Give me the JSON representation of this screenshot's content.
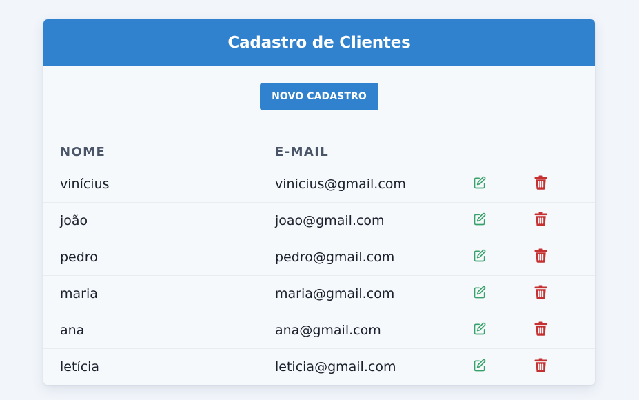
{
  "header": {
    "title": "Cadastro de Clientes"
  },
  "actions": {
    "new_label": "NOVO CADASTRO"
  },
  "table": {
    "columns": [
      "NOME",
      "E-MAIL"
    ],
    "rows": [
      {
        "name": "vinícius",
        "email": "vinicius@gmail.com"
      },
      {
        "name": "joão",
        "email": "joao@gmail.com"
      },
      {
        "name": "pedro",
        "email": "pedro@gmail.com"
      },
      {
        "name": "maria",
        "email": "maria@gmail.com"
      },
      {
        "name": "ana",
        "email": "ana@gmail.com"
      },
      {
        "name": "letícia",
        "email": "leticia@gmail.com"
      }
    ]
  },
  "icons": {
    "edit": "edit-icon",
    "delete": "trash-icon"
  },
  "colors": {
    "accent": "#3182ce",
    "edit": "#38a169",
    "delete": "#c53030"
  }
}
